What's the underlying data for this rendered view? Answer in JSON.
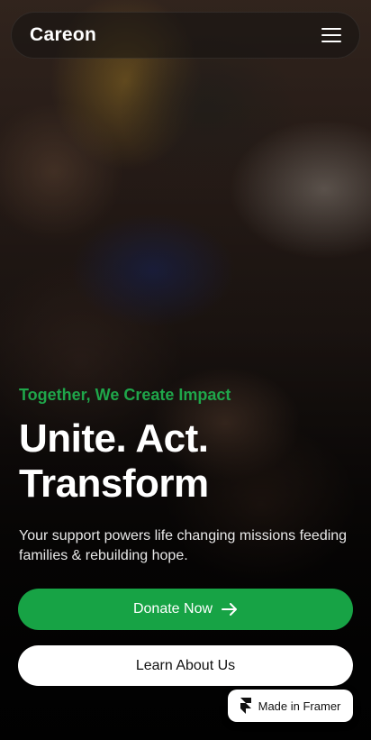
{
  "brand": {
    "name": "Careon"
  },
  "hero": {
    "tagline": "Together, We Create Impact",
    "headline_line1": "Unite. Act.",
    "headline_line2": "Transform",
    "description": "Your support powers life changing missions feeding families & rebuilding hope."
  },
  "actions": {
    "donate_label": "Donate Now",
    "learn_label": "Learn About Us"
  },
  "badge": {
    "label": "Made in Framer"
  },
  "colors": {
    "accent": "#17a345",
    "tagline": "#1fa64a"
  },
  "icons": {
    "menu": "hamburger-menu-icon",
    "arrow": "arrow-right-icon",
    "framer": "framer-logo-icon"
  }
}
